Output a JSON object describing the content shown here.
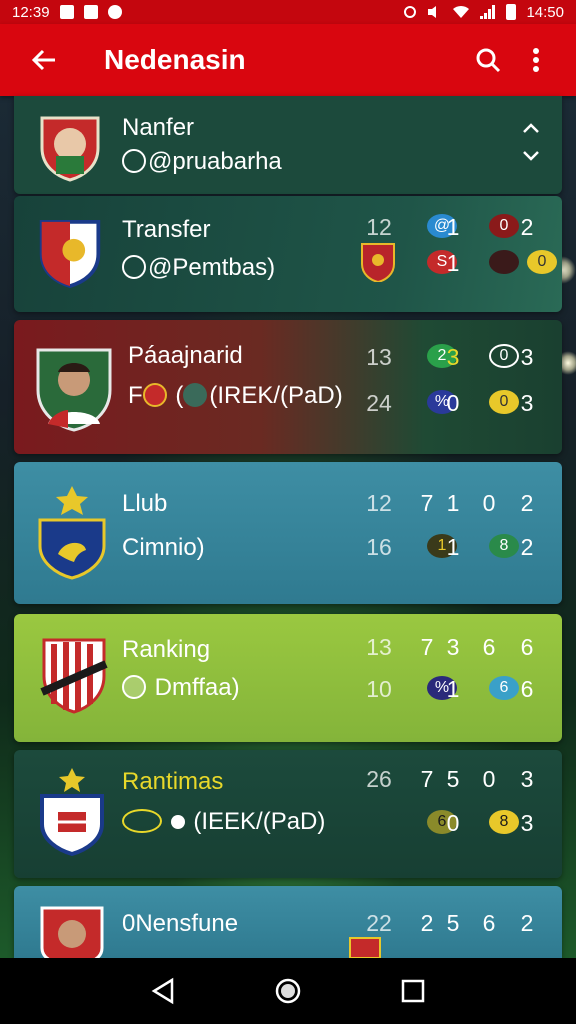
{
  "status_bar": {
    "time_left": "12:39",
    "time_right": "14:50"
  },
  "app_bar": {
    "title": "Nedenasin"
  },
  "cards": [
    {
      "name": "Nanfer",
      "sub": "@pruabarha",
      "row1": [],
      "row2": []
    },
    {
      "name": "Transfer",
      "sub": "@Pemtbas)",
      "row1": [
        "12",
        "@",
        "1",
        "0",
        "2"
      ],
      "row2": [
        "",
        "S",
        "1",
        "",
        "0"
      ]
    },
    {
      "name": "Páaajnarid",
      "sub": "(IREK/(PaD)",
      "sub_prefix": "F",
      "row1": [
        "13",
        "2",
        "3",
        "0",
        "3"
      ],
      "row2": [
        "24",
        "%",
        "0",
        "0",
        "3"
      ]
    },
    {
      "name": "Llub",
      "sub": "Cimnio)",
      "row1": [
        "12",
        "7",
        "1",
        "0",
        "2"
      ],
      "row2": [
        "16",
        "1",
        "1",
        "8",
        "2"
      ]
    },
    {
      "name": "Ranking",
      "sub": "Dmffaa)",
      "row1": [
        "13",
        "7",
        "3",
        "6",
        "6"
      ],
      "row2": [
        "10",
        "%",
        "1",
        "6",
        "6"
      ]
    },
    {
      "name": "Rantimas",
      "sub": "(IEEK/(PaD)",
      "row1": [
        "26",
        "7",
        "5",
        "0",
        "3"
      ],
      "row2": [
        "",
        "6",
        "0",
        "8",
        "3"
      ]
    },
    {
      "name": "0Nensfune",
      "sub": "",
      "row1": [
        "22",
        "2",
        "5",
        "6",
        "2"
      ],
      "row2": []
    }
  ],
  "colors": {
    "app_bar": "#d9060f",
    "card_dark_green": "#1c4a3c",
    "card_red": "#7a1a1e",
    "card_teal": "#3b8aa0",
    "card_lime": "#8fc03a"
  },
  "icons": {
    "back": "arrow-left-icon",
    "search": "search-icon",
    "menu": "more-vert-icon",
    "collapse": "chevron-up-icon",
    "expand": "chevron-down-icon"
  }
}
